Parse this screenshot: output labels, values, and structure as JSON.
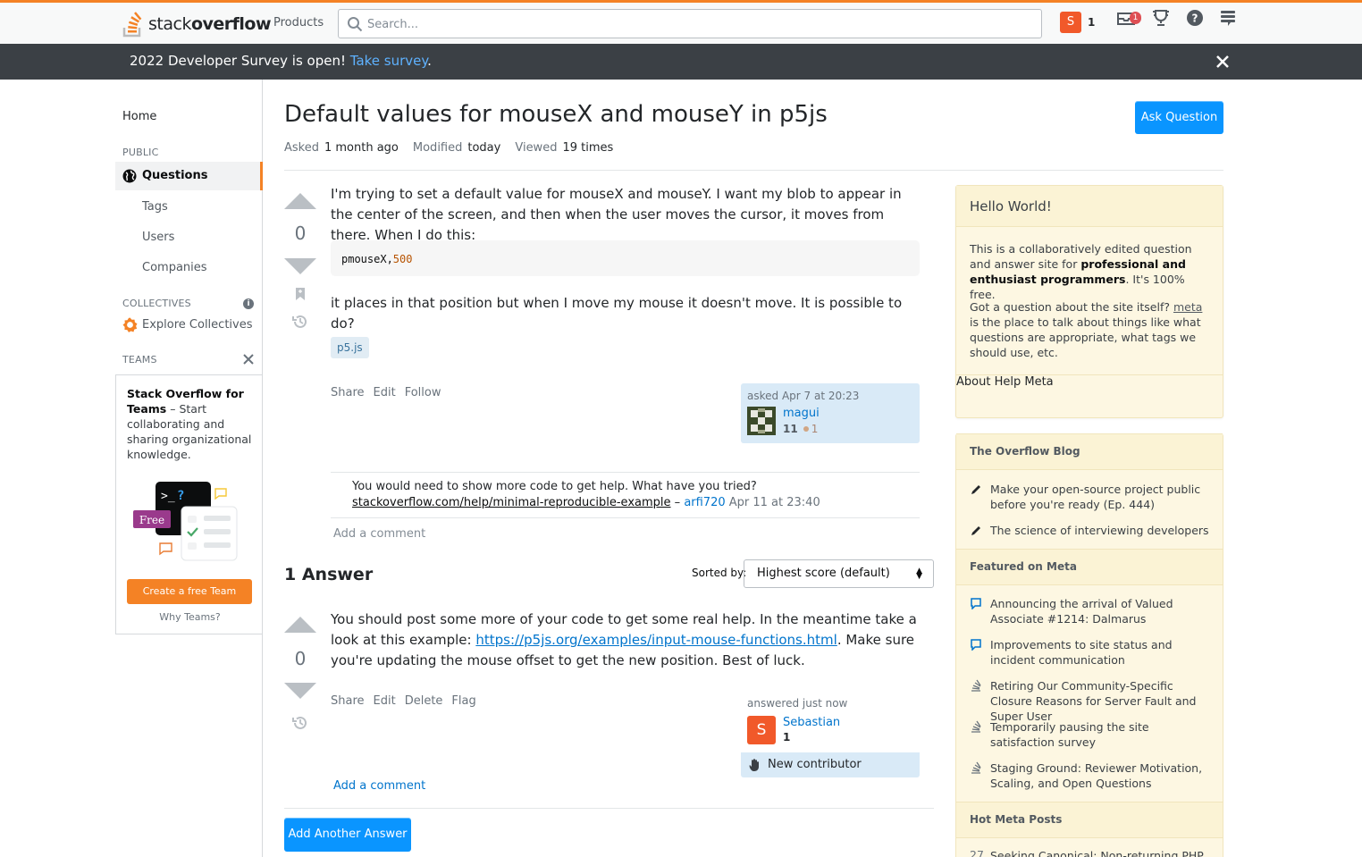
{
  "topbar": {
    "logo_text_a": "stack",
    "logo_text_b": "overflow",
    "products_label": "Products",
    "search_placeholder": "Search...",
    "avatar_letter": "S",
    "reputation": "1",
    "inbox_badge": "1",
    "accent_color": "#f48225"
  },
  "banner": {
    "text": "2022 Developer Survey is open!",
    "link": "Take survey",
    "suffix": "."
  },
  "sidebar": {
    "home": "Home",
    "public_label": "PUBLIC",
    "questions": "Questions",
    "tags": "Tags",
    "users": "Users",
    "companies": "Companies",
    "collectives_label": "COLLECTIVES",
    "explore_collectives": "Explore Collectives",
    "teams_label": "TEAMS",
    "teams_title": "Stack Overflow for Teams",
    "teams_desc": " – Start collaborating and sharing organizational knowledge.",
    "free_badge": "Free",
    "create_team": "Create a free Team",
    "why_teams": "Why Teams?"
  },
  "question": {
    "title": "Default values for mouseX and mouseY in p5js",
    "ask_button": "Ask Question",
    "asked_label": "Asked",
    "asked_value": "1 month ago",
    "modified_label": "Modified",
    "modified_value": "today",
    "viewed_label": "Viewed",
    "viewed_value": "19 times",
    "votes": "0",
    "body_1": "I'm trying to set a default value for mouseX and mouseY. I want my blob to appear in the center of the screen, and then when the user moves the cursor, it moves from there. When I do this:",
    "code_text": "pmouseX,",
    "code_num": "500",
    "body_2": "it places in that position but when I move my mouse it doesn't move. It is possible to do?",
    "tag": "p5.js",
    "menu": [
      "Share",
      "Edit",
      "Follow"
    ],
    "owner_time": "asked Apr 7 at 20:23",
    "owner_name": "magui",
    "owner_rep": "11",
    "owner_bronze": "1",
    "comment_text": "You would need to show more code to get help. What have you tried?",
    "comment_link": "stackoverflow.com/help/minimal-reproducible-example",
    "comment_dash": "–",
    "comment_user": "arfi720",
    "comment_date": "Apr 11 at 23:40",
    "add_comment": "Add a comment"
  },
  "answers": {
    "header": "1 Answer",
    "sorted_by": "Sorted by:",
    "sort_value": "Highest score (default)",
    "votes": "0",
    "body_a": "You should post some more of your code to get some real help. In the meantime take a look at this example:",
    "body_link": "https://p5js.org/examples/input-mouse-functions.html",
    "body_b": ". Make sure you're updating the mouse offset to get the new position. Best of luck.",
    "menu": [
      "Share",
      "Edit",
      "Delete",
      "Flag"
    ],
    "answered_time": "answered just now",
    "author_letter": "S",
    "author_name": "Sebastian",
    "author_rep": "1",
    "new_contributor": "New contributor",
    "add_comment": "Add a comment",
    "add_answer": "Add Another Answer"
  },
  "right": {
    "hello_title": "Hello World!",
    "hello_p1_a": "This is a collaboratively edited question and answer site for ",
    "hello_p1_b": "professional and enthusiast programmers",
    "hello_p1_c": ". It's 100% free.",
    "hello_p2_a": "Got a question about the site itself? ",
    "hello_p2_link": "meta",
    "hello_p2_b": " is the place to talk about things like what questions are appropriate, what tags we should use, etc.",
    "footer": [
      "About",
      "Help",
      "Meta"
    ],
    "blog_title": "The Overflow Blog",
    "blog_items": [
      "Make your open-source project public before you're ready (Ep. 444)",
      "The science of interviewing developers"
    ],
    "featured_title": "Featured on Meta",
    "featured_items": [
      "Announcing the arrival of Valued Associate #1214: Dalmarus",
      "Improvements to site status and incident communication",
      "Retiring Our Community-Specific Closure Reasons for Server Fault and Super User",
      "Temporarily pausing the site satisfaction survey",
      "Staging Ground: Reviewer Motivation, Scaling, and Open Questions"
    ],
    "hot_title": "Hot Meta Posts",
    "hot_count": "27",
    "hot_item": "Seeking Canonical: Non-returning PHP"
  }
}
